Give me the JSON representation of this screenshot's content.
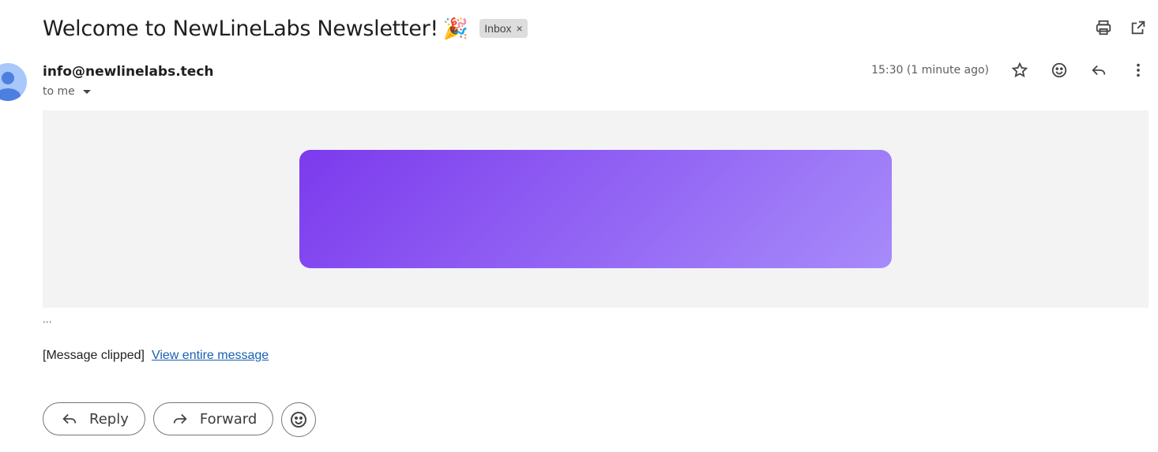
{
  "email": {
    "subject": "Welcome to NewLineLabs Newsletter!",
    "subject_emoji": "🎉",
    "label": "Inbox",
    "label_remove": "×",
    "sender": "info@newlinelabs.tech",
    "recipient": "to me",
    "timestamp": "15:30 (1 minute ago)",
    "ellipsis": "...",
    "clipped_text": "[Message clipped]",
    "view_entire": "View entire message"
  },
  "actions": {
    "reply_label": "Reply",
    "forward_label": "Forward"
  },
  "icons": {
    "print": "print-icon",
    "open_new_window": "open-in-new-window-icon",
    "star": "star-icon",
    "emoji": "emoji-icon",
    "reply": "reply-icon",
    "more": "more-vert-icon"
  },
  "colors": {
    "banner_start": "#7c3aed",
    "banner_end": "#a78bfa",
    "link": "#1a5fb4"
  }
}
